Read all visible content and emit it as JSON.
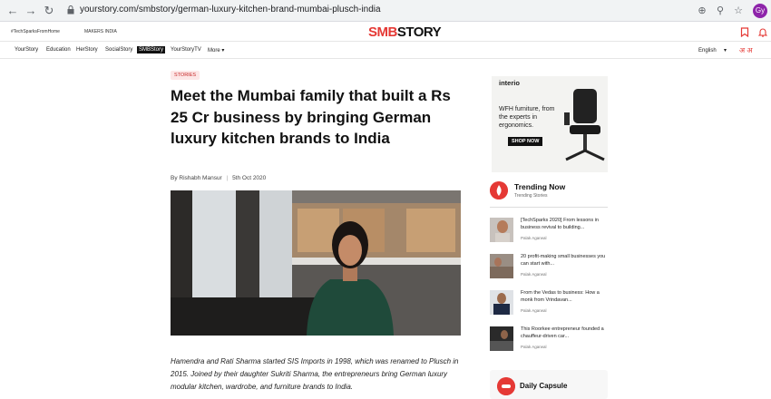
{
  "browser": {
    "url": "yourstory.com/smbstory/german-luxury-kitchen-brand-mumbai-plusch-india",
    "avatar_initials": "Gy"
  },
  "topstrip": {
    "hashtag": "#TechSparksFromHome",
    "makers": "MAKERS INDIA",
    "logo_smb": "SMB",
    "logo_story": "STORY"
  },
  "nav": {
    "items": [
      "YourStory",
      "Education",
      "HerStory",
      "SocialStory",
      "SMBStory",
      "YourStoryTV",
      "More"
    ],
    "language": "English",
    "lang_glyphs": "अ अ"
  },
  "article": {
    "category": "STORIES",
    "headline": "Meet the Mumbai family that built a Rs 25 Cr business by bringing German luxury kitchen brands to India",
    "author": "By Rishabh Mansur",
    "date": "5th Oct 2020",
    "intro": "Hamendra and Rati Sharma started SIS Imports in 1998, which was renamed to Plusch in 2015. Joined by their daughter Sukriti Sharma, the entrepreneurs bring German luxury modular kitchen, wardrobe, and furniture brands to India."
  },
  "ad": {
    "brand": "interio",
    "text": "WFH furniture, from the experts in ergonomics.",
    "cta": "SHOP NOW"
  },
  "trending": {
    "title": "Trending Now",
    "subtitle": "Trending Stories",
    "items": [
      {
        "text": "[TechSparks 2020] From lessons in business revival to building...",
        "author": "Palak Agarwal"
      },
      {
        "text": "20 profit-making small businesses you can start with...",
        "author": "Palak Agarwal"
      },
      {
        "text": "From the Vedas to business: How a monk from Vrindavan...",
        "author": "Palak Agarwal"
      },
      {
        "text": "This Roorkee entrepreneur founded a chauffeur-driven car...",
        "author": "Palak Agarwal"
      }
    ]
  },
  "capsule": {
    "label": "Daily Capsule"
  },
  "colors": {
    "brand_red": "#e53935",
    "nav_active_bg": "#111111"
  }
}
